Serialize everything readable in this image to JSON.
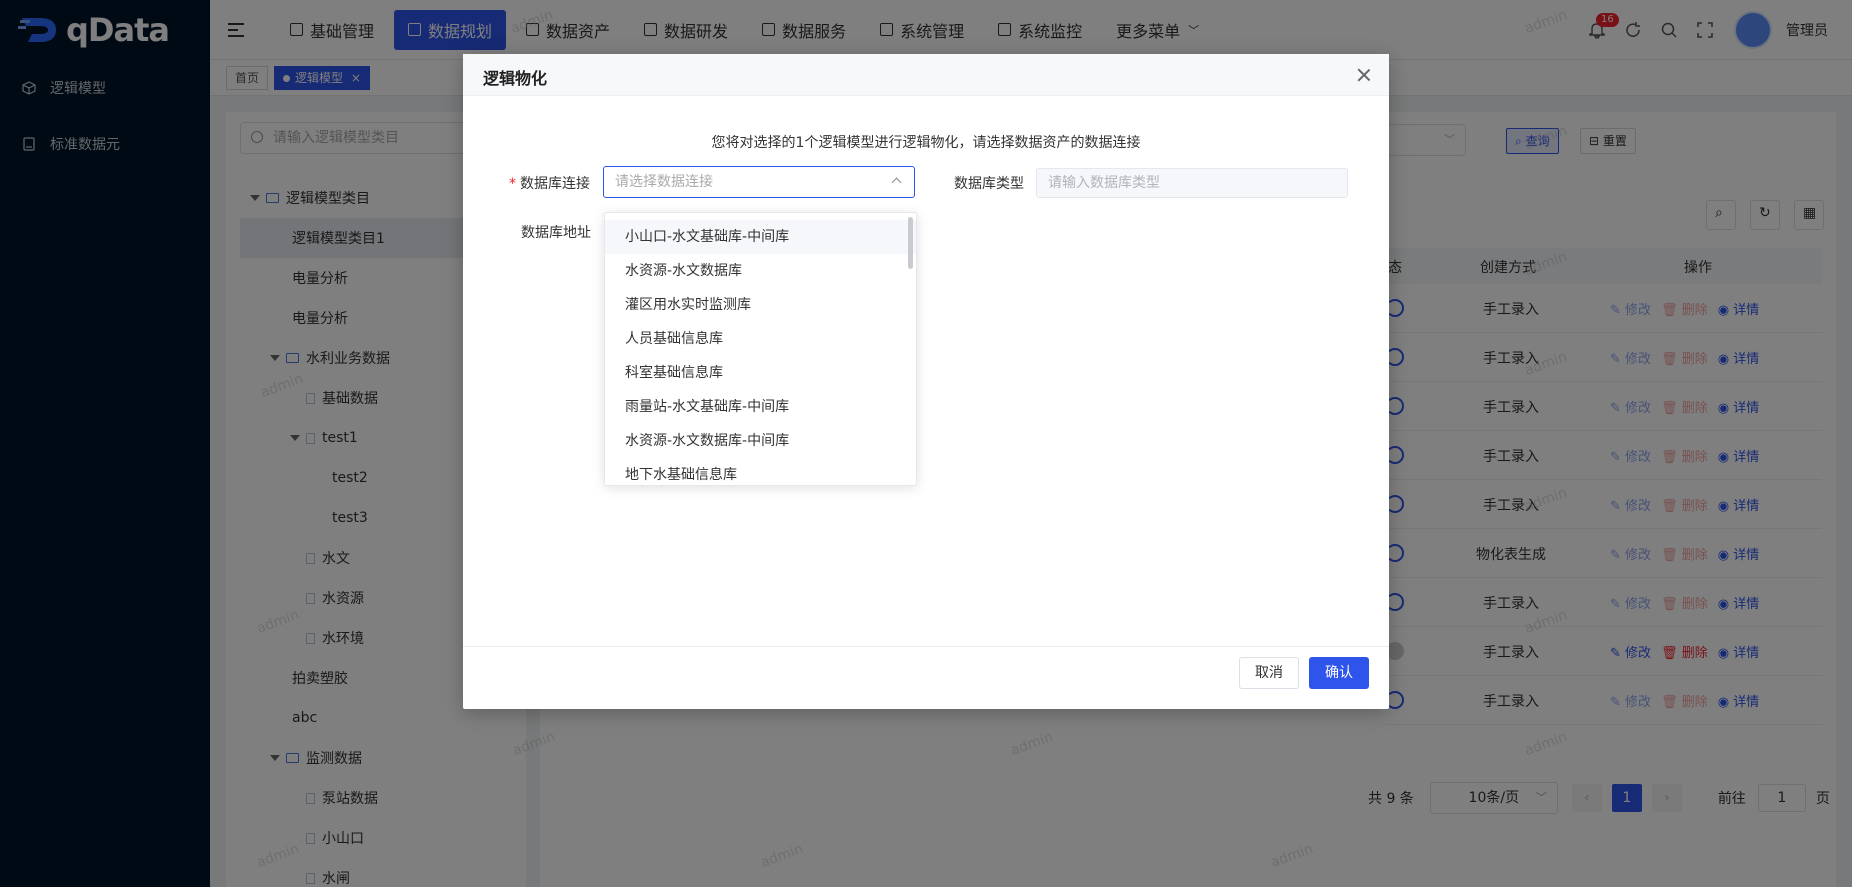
{
  "app": {
    "logo_text": "qData"
  },
  "sidebar": {
    "items": [
      {
        "label": "逻辑模型",
        "icon": "cube-icon"
      },
      {
        "label": "标准数据元",
        "icon": "document-icon"
      }
    ]
  },
  "header": {
    "nav": [
      {
        "label": "基础管理",
        "active": false
      },
      {
        "label": "数据规划",
        "active": true
      },
      {
        "label": "数据资产",
        "active": false
      },
      {
        "label": "数据研发",
        "active": false
      },
      {
        "label": "数据服务",
        "active": false
      },
      {
        "label": "系统管理",
        "active": false
      },
      {
        "label": "系统监控",
        "active": false
      }
    ],
    "more_label": "更多菜单",
    "notification_count": "16",
    "username": "管理员"
  },
  "tags": {
    "home": "首页",
    "current": "逻辑模型"
  },
  "tree": {
    "search_placeholder": "请输入逻辑模型类目",
    "nodes": [
      {
        "label": "逻辑模型类目",
        "level": 0,
        "type": "folder",
        "expanded": true
      },
      {
        "label": "逻辑模型类目1",
        "level": 1,
        "type": "leaf",
        "selected": true
      },
      {
        "label": "电量分析",
        "level": 1,
        "type": "leaf"
      },
      {
        "label": "电量分析",
        "level": 1,
        "type": "leaf"
      },
      {
        "label": "水利业务数据",
        "level": 1,
        "type": "folder",
        "expanded": true
      },
      {
        "label": "基础数据",
        "level": 2,
        "type": "file"
      },
      {
        "label": "test1",
        "level": 2,
        "type": "file-parent",
        "expanded": true
      },
      {
        "label": "test2",
        "level": 3,
        "type": "leaf"
      },
      {
        "label": "test3",
        "level": 3,
        "type": "leaf"
      },
      {
        "label": "水文",
        "level": 2,
        "type": "file"
      },
      {
        "label": "水资源",
        "level": 2,
        "type": "file"
      },
      {
        "label": "水环境",
        "level": 2,
        "type": "file"
      },
      {
        "label": "拍卖塑胶",
        "level": 1,
        "type": "leaf"
      },
      {
        "label": "abc",
        "level": 1,
        "type": "leaf"
      },
      {
        "label": "监测数据",
        "level": 1,
        "type": "folder",
        "expanded": true
      },
      {
        "label": "泵站数据",
        "level": 2,
        "type": "file"
      },
      {
        "label": "小山口",
        "level": 2,
        "type": "file"
      },
      {
        "label": "水闸",
        "level": 2,
        "type": "file"
      }
    ]
  },
  "toolbar": {
    "query_label": "查询",
    "reset_label": "重置"
  },
  "table": {
    "headers": {
      "status": "态",
      "method": "创建方式",
      "ops": "操作"
    },
    "ops": {
      "edit": "修改",
      "delete": "删除",
      "detail": "详情"
    },
    "rows": [
      {
        "method": "手工录入",
        "status_on": true,
        "strong": false
      },
      {
        "method": "手工录入",
        "status_on": true,
        "strong": false
      },
      {
        "method": "手工录入",
        "status_on": true,
        "strong": false
      },
      {
        "method": "手工录入",
        "status_on": true,
        "strong": false
      },
      {
        "method": "手工录入",
        "status_on": true,
        "strong": false
      },
      {
        "method": "物化表生成",
        "status_on": true,
        "strong": false
      },
      {
        "method": "手工录入",
        "status_on": true,
        "strong": false
      },
      {
        "method": "手工录入",
        "status_on": false,
        "strong": true
      },
      {
        "method": "手工录入",
        "status_on": true,
        "strong": false
      }
    ]
  },
  "pagination": {
    "total": "共 9 条",
    "page_size": "10条/页",
    "current_page": "1",
    "goto_label": "前往",
    "goto_value": "1",
    "page_unit": "页"
  },
  "dialog": {
    "title": "逻辑物化",
    "notice": "您将对选择的1个逻辑模型进行逻辑物化，请选择数据资产的数据连接",
    "conn_label": "数据库连接",
    "conn_placeholder": "请选择数据连接",
    "type_label": "数据库类型",
    "type_placeholder": "请输入数据库类型",
    "addr_label": "数据库地址",
    "cancel_label": "取消",
    "ok_label": "确认",
    "options": [
      "小山口-水文基础库-中间库",
      "水资源-水文数据库",
      "灌区用水实时监测库",
      "人员基础信息库",
      "科室基础信息库",
      "雨量站-水文基础库-中间库",
      "水资源-水文数据库-中间库",
      "地下水基础信息库"
    ]
  },
  "watermark": "admin",
  "colors": {
    "primary": "#2f54eb",
    "sidebar": "#001529",
    "danger": "#f5222d"
  }
}
